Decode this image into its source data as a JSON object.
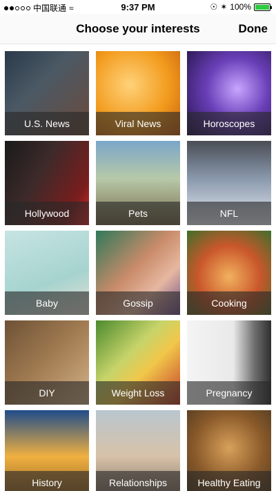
{
  "status_bar": {
    "carrier": "中国联通",
    "time": "9:37 PM",
    "battery": "100%",
    "battery_level": 1.0
  },
  "nav": {
    "title": "Choose your interests",
    "done_label": "Done"
  },
  "interests": [
    {
      "label": "U.S. News"
    },
    {
      "label": "Viral News"
    },
    {
      "label": "Horoscopes"
    },
    {
      "label": "Hollywood"
    },
    {
      "label": "Pets"
    },
    {
      "label": "NFL"
    },
    {
      "label": "Baby"
    },
    {
      "label": "Gossip"
    },
    {
      "label": "Cooking"
    },
    {
      "label": "DIY"
    },
    {
      "label": "Weight Loss"
    },
    {
      "label": "Pregnancy"
    },
    {
      "label": "History"
    },
    {
      "label": "Relationships"
    },
    {
      "label": "Healthy Eating"
    }
  ]
}
